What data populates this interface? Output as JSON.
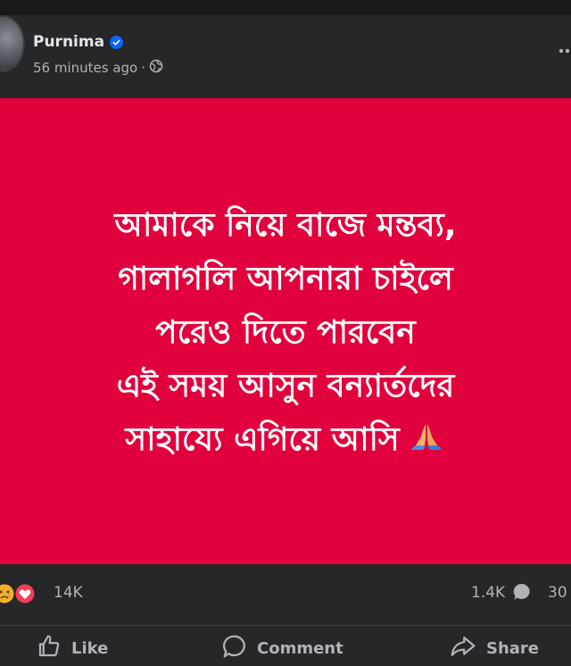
{
  "post": {
    "author": "Purnima",
    "timestamp": "56 minutes ago",
    "separator": "·",
    "privacy_icon": "globe-icon",
    "verified_icon": "verified-badge-icon",
    "more_icon": "more-horizontal-icon"
  },
  "image": {
    "background": "#e0013d",
    "lines": [
      "আমাকে নিয়ে বাজে মন্তব্য,",
      "গালাগলি আপনারা চাইলে",
      "পরেও দিতে পারবেন",
      "এই সময় আসুন বন্যার্তদের",
      "সাহায্যে এগিয়ে আসি"
    ],
    "emoji_icon": "folded-hands-icon"
  },
  "stats": {
    "reactions_count": "14K",
    "reaction_icons": [
      "sad-icon",
      "love-icon"
    ],
    "comments_count": "1.4K",
    "shares_count": "30"
  },
  "actions": {
    "like_label": "Like",
    "comment_label": "Comment",
    "share_label": "Share"
  },
  "colors": {
    "accent": "#0866ff",
    "love": "#f33e58",
    "sad": "#f7b125"
  }
}
